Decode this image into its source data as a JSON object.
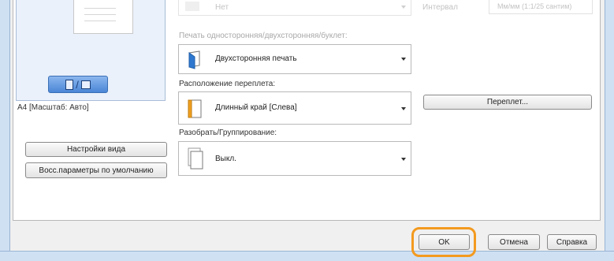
{
  "preview": {
    "caption": "A4 [Масштаб: Авто]",
    "settings_button": "Настройки вида",
    "restore_button": "Восс.параметры по умолчанию"
  },
  "faded_top": {
    "combo_value": "Нет",
    "right_label": "Интервал",
    "right_field": "Мм/мм (1:1/25 сантим)"
  },
  "print_style": {
    "label": "Печать односторонняя/двухсторонняя/буклет:",
    "value": "Двухсторонняя печать"
  },
  "binding": {
    "label": "Расположение переплета:",
    "value": "Длинный край [Слева]",
    "button": "Переплет..."
  },
  "collate": {
    "label": "Разобрать/Группирование:",
    "value": "Выкл."
  },
  "footer": {
    "ok": "OK",
    "cancel": "Отмена",
    "help": "Справка"
  },
  "colors": {
    "highlight_ring": "#f39a1f",
    "binding_accent": "#f0a020"
  }
}
